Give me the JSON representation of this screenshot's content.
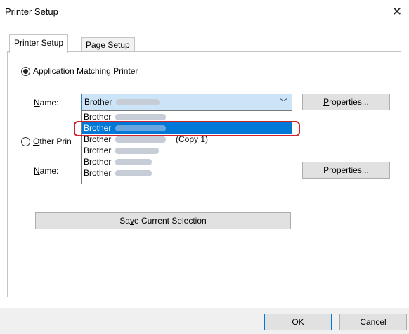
{
  "window": {
    "title": "Printer Setup"
  },
  "tabs": [
    {
      "label": "Printer Setup"
    },
    {
      "label": "Page Setup"
    }
  ],
  "app_printer": {
    "radio_label_prefix": "Application ",
    "radio_label_key": "M",
    "radio_label_suffix": "atching Printer",
    "name_label_prefix": "N",
    "name_label_suffix": "ame:",
    "selected_value": "Brother",
    "properties_prefix": "P",
    "properties_suffix": "roperties..."
  },
  "other_printer": {
    "radio_label_key": "O",
    "radio_label_suffix": "ther Prin",
    "name_label_prefix": "N",
    "name_label_suffix": "ame:",
    "properties_prefix": "P",
    "properties_suffix": "roperties..."
  },
  "dropdown": {
    "items": [
      {
        "label": "Brother",
        "suffix": ""
      },
      {
        "label": "Brother",
        "suffix": ""
      },
      {
        "label": "Brother",
        "suffix": "(Copy 1)"
      },
      {
        "label": "Brother",
        "suffix": ""
      },
      {
        "label": "Brother",
        "suffix": ""
      },
      {
        "label": "Brother",
        "suffix": ""
      }
    ],
    "selected_index": 1
  },
  "save_button": {
    "prefix": "Sa",
    "key": "v",
    "suffix": "e Current Selection"
  },
  "footer": {
    "ok_label": "OK",
    "cancel_label": "Cancel"
  },
  "icons": {
    "close": "close-icon",
    "chevron": "chevron-down-icon"
  },
  "colors": {
    "highlight": "#0078d7",
    "annotation": "#d0202a"
  }
}
